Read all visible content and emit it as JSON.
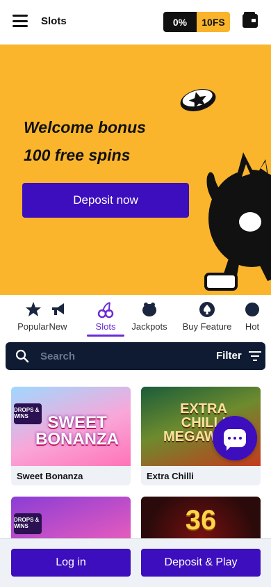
{
  "header": {
    "title": "Slots",
    "bonus_percent": "0%",
    "bonus_free_spins": "10FS"
  },
  "hero": {
    "line1": "Welcome bonus",
    "line2": "100 free spins",
    "cta": "Deposit now"
  },
  "tabs": [
    {
      "label": "Popular",
      "icon": "star-icon"
    },
    {
      "label": "New",
      "icon": "megaphone-icon"
    },
    {
      "label": "Slots",
      "icon": "cherries-icon",
      "active": true
    },
    {
      "label": "Jackpots",
      "icon": "pig-icon"
    },
    {
      "label": "Buy Feature",
      "icon": "shopping-spade-icon"
    },
    {
      "label": "Hot",
      "icon": "fire-icon"
    }
  ],
  "search": {
    "placeholder": "Search",
    "filter_label": "Filter"
  },
  "games": [
    {
      "name": "Sweet Bonanza",
      "logo": "SWEET BONANZA",
      "badge": "DROPS & WINS"
    },
    {
      "name": "Extra Chilli",
      "logo": "EXTRA CHILLI MEGAWAYS"
    },
    {
      "name": "",
      "logo": "",
      "badge": "DROPS & WINS"
    },
    {
      "name": "",
      "logo": "36"
    }
  ],
  "bottom": {
    "login": "Log in",
    "deposit_play": "Deposit & Play"
  },
  "colors": {
    "accent": "#3d0ebd",
    "hero_bg": "#fbb52c",
    "tab_active": "#6a2ad6",
    "search_bg": "#0f1b33"
  }
}
